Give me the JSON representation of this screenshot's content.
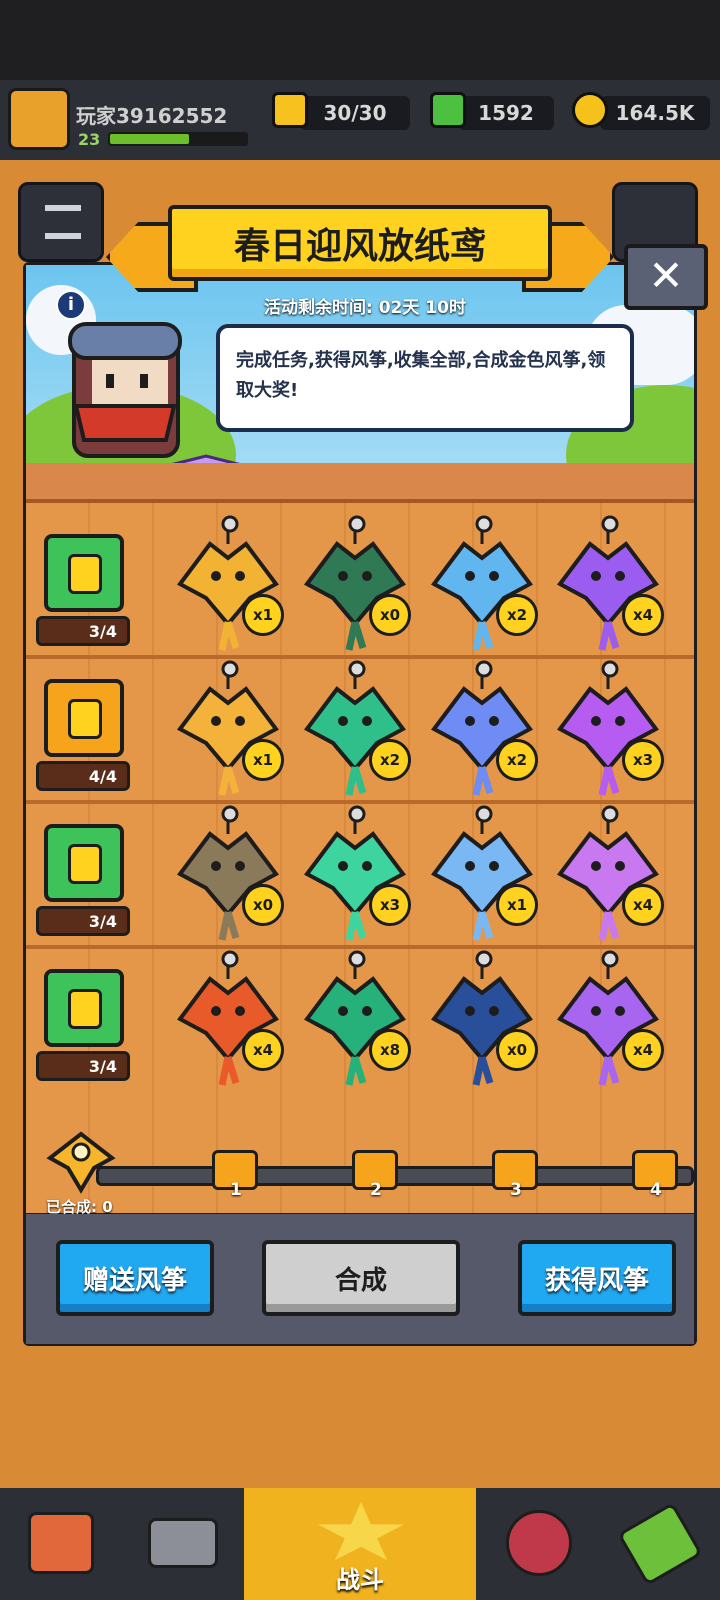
{
  "header": {
    "player_name": "玩家39162552",
    "level": "23",
    "xp_progress": 0.58
  },
  "resources": {
    "energy": "30/30",
    "gems": "1592",
    "coins": "164.5K"
  },
  "event": {
    "title": "春日迎风放纸鸢",
    "time_remaining": "活动剩余时间: 02天 10时",
    "description": "完成任务,获得风筝,收集全部,合成金色风筝,领取大奖!"
  },
  "rows": [
    {
      "chest_count": "3/4",
      "chest_open": false,
      "kites": [
        {
          "count": "x1",
          "color": "#f2b233"
        },
        {
          "count": "x0",
          "color": "#2f7a55"
        },
        {
          "count": "x2",
          "color": "#62b6f0"
        },
        {
          "count": "x4",
          "color": "#9b5df0"
        }
      ]
    },
    {
      "chest_count": "4/4",
      "chest_open": true,
      "kites": [
        {
          "count": "x1",
          "color": "#f4b23b"
        },
        {
          "count": "x2",
          "color": "#2fbf8a"
        },
        {
          "count": "x2",
          "color": "#6f8cf4"
        },
        {
          "count": "x3",
          "color": "#b65cf0"
        }
      ]
    },
    {
      "chest_count": "3/4",
      "chest_open": false,
      "kites": [
        {
          "count": "x0",
          "color": "#8a7a5a"
        },
        {
          "count": "x3",
          "color": "#3ed4a0"
        },
        {
          "count": "x1",
          "color": "#7ab8f4"
        },
        {
          "count": "x4",
          "color": "#c879f0"
        }
      ]
    },
    {
      "chest_count": "3/4",
      "chest_open": false,
      "kites": [
        {
          "count": "x4",
          "color": "#e85a2a"
        },
        {
          "count": "x8",
          "color": "#26b07a"
        },
        {
          "count": "x0",
          "color": "#2a4f9a"
        },
        {
          "count": "x4",
          "color": "#a865f0"
        }
      ]
    }
  ],
  "progress": {
    "milestones": [
      "1",
      "2",
      "3",
      "4"
    ],
    "synthesized_label": "已合成: 0"
  },
  "buttons": {
    "gift": "赠送风筝",
    "synthesize": "合成",
    "obtain": "获得风筝"
  },
  "nav": {
    "battle": "战斗"
  }
}
